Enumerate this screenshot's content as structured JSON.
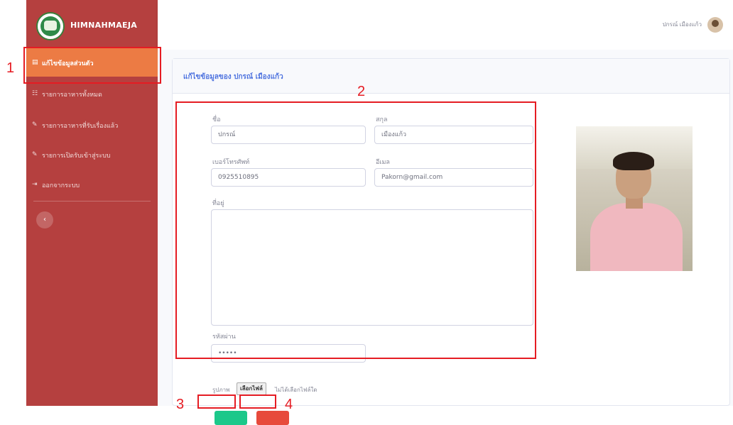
{
  "sidebar": {
    "brand": "HIMNAHMAEJA",
    "items": [
      {
        "icon": "▤",
        "label": "แก้ไขข้อมูลส่วนตัว",
        "active": true
      },
      {
        "icon": "☷",
        "label": "รายการอาหารทั้งหมด",
        "active": false
      },
      {
        "icon": "✎",
        "label": "รายการอาหารที่รับเรื่องแล้ว",
        "active": false
      },
      {
        "icon": "✎",
        "label": "รายการเปิดรับเข้าสู่ระบบ",
        "active": false
      },
      {
        "icon": "⇥",
        "label": "ออกจากระบบ",
        "active": false
      }
    ],
    "toggle_icon": "‹"
  },
  "topbar": {
    "user_name": "ปกรณ์ เมืองแก้ว"
  },
  "card": {
    "title": "แก้ไขข้อมูลของ ปกรณ์ เมืองแก้ว",
    "first_name_label": "ชื่อ",
    "first_name_value": "ปกรณ์",
    "last_name_label": "สกุล",
    "last_name_value": "เมืองแก้ว",
    "phone_label": "เบอร์โทรศัพท์",
    "phone_value": "0925510895",
    "email_label": "อีเมล",
    "email_value": "Pakorn@gmail.com",
    "address_label": "ที่อยู่",
    "address_value": "",
    "password_label": "รหัสผ่าน",
    "password_value": "•••••",
    "image_label": "รูปภาพ",
    "file_button": "เลือกไฟล์",
    "file_status": "ไม่ได้เลือกไฟล์ใด"
  },
  "annotations": {
    "n1": "1",
    "n2": "2",
    "n3": "3",
    "n4": "4"
  },
  "colors": {
    "sidebar": "#b5403f",
    "active_item": "#ec7b44",
    "save": "#1cc88a",
    "cancel": "#e74a3b",
    "annotation": "#e51c23"
  }
}
